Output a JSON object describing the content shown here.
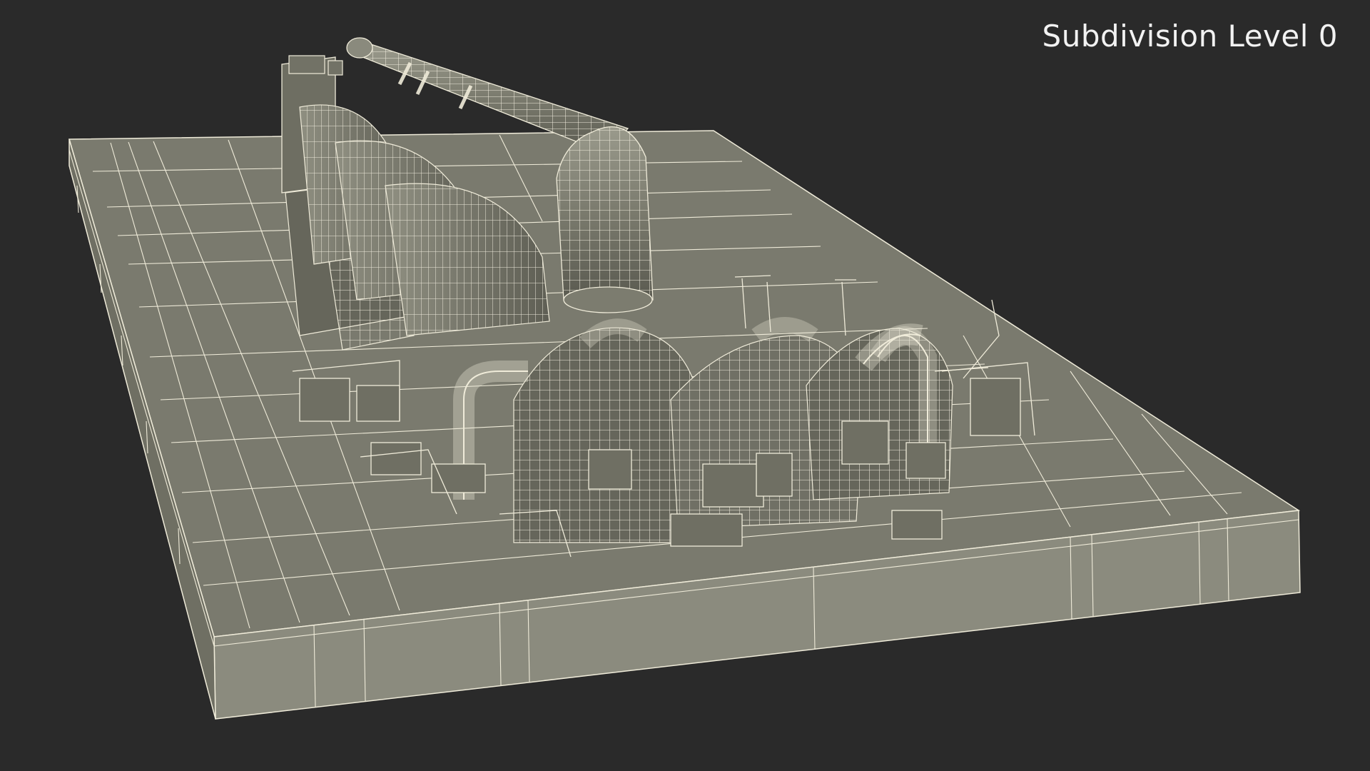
{
  "viewport": {
    "overlay_label": "Subdivision Level 0",
    "background_color": "#2a2a2a",
    "wire_color": "#f0ecd8",
    "surface_color": "#7c7c6f",
    "side_color": "#8a8a7d",
    "dark_color": "#4b4b43"
  }
}
